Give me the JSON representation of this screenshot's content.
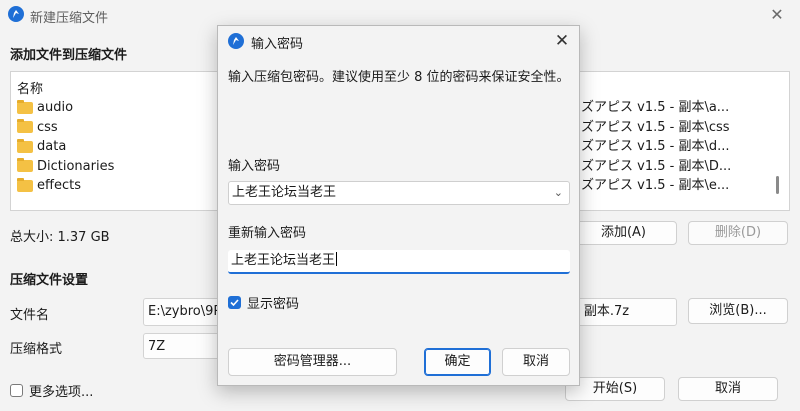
{
  "main": {
    "title": "新建压缩文件",
    "section_add": "添加文件到压缩文件",
    "column_name": "名称",
    "files": [
      "audio",
      "css",
      "data",
      "Dictionaries",
      "effects"
    ],
    "paths": [
      "ズアピス v1.5 - 副本\\a...",
      "ズアピス v1.5 - 副本\\css",
      "ズアピス v1.5 - 副本\\d...",
      "ズアピス v1.5 - 副本\\D...",
      "ズアピス v1.5 - 副本\\e..."
    ],
    "total_size": "总大小: 1.37 GB",
    "add_button": "添加(A)",
    "remove_button": "删除(D)",
    "section_settings": "压缩文件设置",
    "filename_label": "文件名",
    "filename_value": "E:\\zybro\\9R.",
    "filename_value_right": "- 副本.7z",
    "browse_button": "浏览(B)...",
    "format_label": "压缩格式",
    "format_value": "7Z",
    "more_options": "更多选项...",
    "start_button": "开始(S)",
    "cancel_button": "取消"
  },
  "dialog": {
    "title": "输入密码",
    "description": "输入压缩包密码。建议使用至少 8 位的密码来保证安全性。",
    "password_label": "输入密码",
    "password_value": "上老王论坛当老王",
    "confirm_label": "重新输入密码",
    "confirm_value": "上老王论坛当老王",
    "show_password": "显示密码",
    "show_password_checked": true,
    "manager_button": "密码管理器...",
    "ok_button": "确定",
    "cancel_button": "取消"
  },
  "colors": {
    "accent": "#1f6fd6",
    "folder": "#f4c144"
  }
}
